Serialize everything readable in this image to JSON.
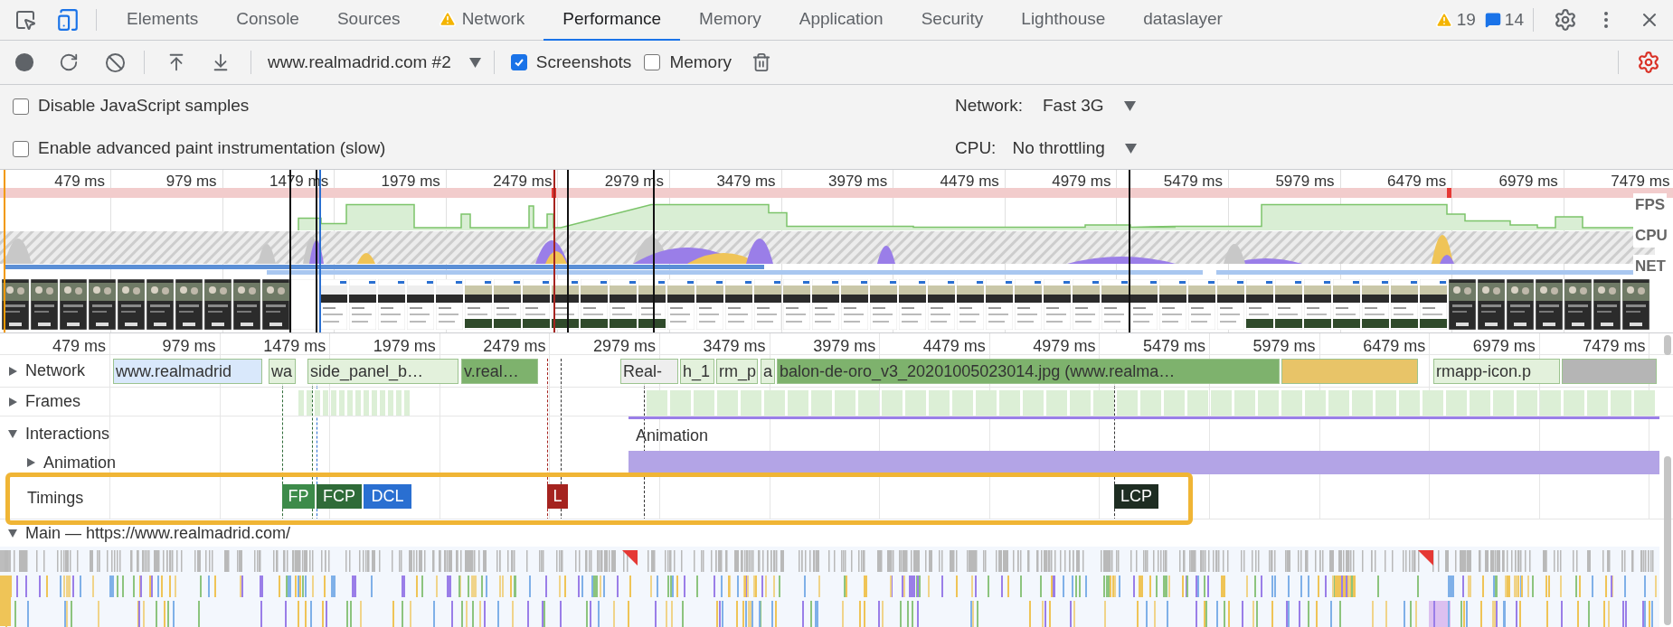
{
  "tabs": [
    {
      "label": "Elements",
      "selected": false,
      "warning": false
    },
    {
      "label": "Console",
      "selected": false,
      "warning": false
    },
    {
      "label": "Sources",
      "selected": false,
      "warning": false
    },
    {
      "label": "Network",
      "selected": false,
      "warning": true
    },
    {
      "label": "Performance",
      "selected": true,
      "warning": false
    },
    {
      "label": "Memory",
      "selected": false,
      "warning": false
    },
    {
      "label": "Application",
      "selected": false,
      "warning": false
    },
    {
      "label": "Security",
      "selected": false,
      "warning": false
    },
    {
      "label": "Lighthouse",
      "selected": false,
      "warning": false
    },
    {
      "label": "dataslayer",
      "selected": false,
      "warning": false
    }
  ],
  "issues": {
    "warnings": "19",
    "messages": "14"
  },
  "toolbar": {
    "recording": "www.realmadrid.com #2",
    "options": [
      {
        "label": "Screenshots",
        "checked": true
      },
      {
        "label": "Memory",
        "checked": false
      }
    ]
  },
  "settings": [
    {
      "label": "Disable JavaScript samples",
      "checked": false
    },
    {
      "label": "Enable advanced paint instrumentation (slow)",
      "checked": false
    }
  ],
  "throttling": [
    {
      "label": "Network:",
      "value": "Fast 3G"
    },
    {
      "label": "CPU:",
      "value": "No throttling"
    }
  ],
  "overview": {
    "ticks": [
      "479 ms",
      "979 ms",
      "1479 ms",
      "1979 ms",
      "2479 ms",
      "2979 ms",
      "3479 ms",
      "3979 ms",
      "4479 ms",
      "4979 ms",
      "5479 ms",
      "5979 ms",
      "6479 ms",
      "6979 ms",
      "7479 ms"
    ],
    "track_labels": [
      "FPS",
      "CPU",
      "NET"
    ]
  },
  "timeline": {
    "ticks": [
      "479 ms",
      "979 ms",
      "1479 ms",
      "1979 ms",
      "2479 ms",
      "2979 ms",
      "3479 ms",
      "3979 ms",
      "4479 ms",
      "4979 ms",
      "5479 ms",
      "5979 ms",
      "6479 ms",
      "6979 ms",
      "7479 ms"
    ],
    "network_track": {
      "label": "Network",
      "expanded": false
    },
    "network_requests": [
      {
        "label": "www.realmadrid",
        "color": "#d9e8fb"
      },
      {
        "label": "wa",
        "color": "#e3f1dc"
      },
      {
        "label": "side_panel_b…",
        "color": "#e3f1dc"
      },
      {
        "label": "v.real…",
        "color": "#7eb26d"
      },
      {
        "label": "Real-",
        "color": "#eeeeee"
      },
      {
        "label": "h_1",
        "color": "#e3f1dc"
      },
      {
        "label": "rm_p",
        "color": "#e3f1dc"
      },
      {
        "label": "a",
        "color": "#e3f1dc"
      },
      {
        "label": "balon-de-oro_v3_20201005023014.jpg (www.realma…",
        "color": "#7eb26d"
      },
      {
        "color": "#e8c468"
      },
      {
        "label": "rmapp-icon.p",
        "color": "#e3f1dc"
      },
      {
        "color": "#b5b5b5"
      }
    ],
    "frames_track": {
      "label": "Frames",
      "expanded": false
    },
    "interactions_track": {
      "label": "Interactions",
      "expanded": true,
      "event": "Animation"
    },
    "animation_track": {
      "label": "Animation",
      "expanded": false
    },
    "timings": {
      "label": "Timings",
      "markers": [
        {
          "label": "FP",
          "color": "#3d8b4a"
        },
        {
          "label": "FCP",
          "color": "#2f6b38"
        },
        {
          "label": "DCL",
          "color": "#2a6fd1"
        },
        {
          "label": "L",
          "color": "#a5231f"
        },
        {
          "label": "LCP",
          "color": "#1e2d22"
        }
      ]
    },
    "main_track": {
      "label": "Main — https://www.realmadrid.com/",
      "expanded": true
    }
  }
}
